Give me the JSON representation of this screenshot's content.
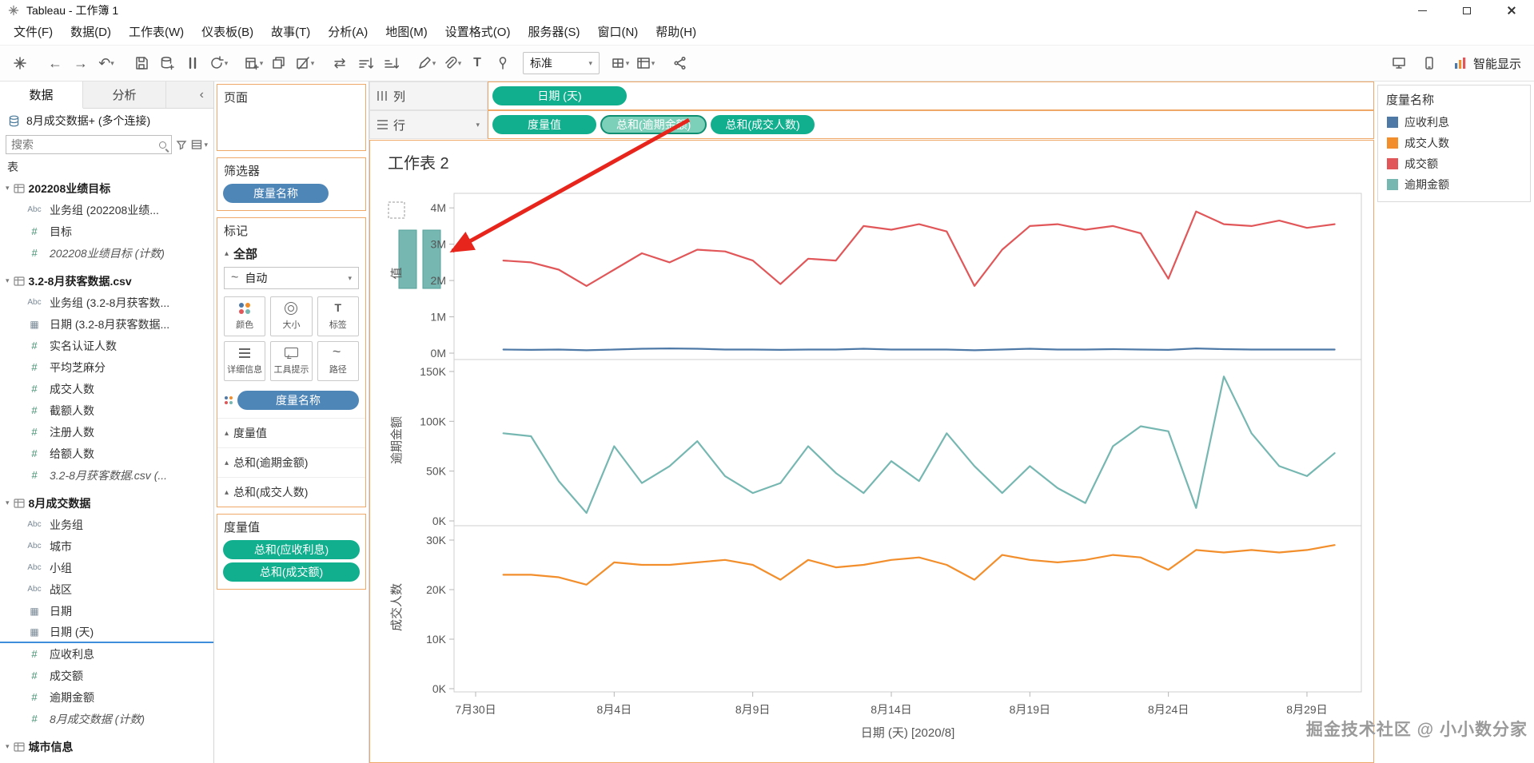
{
  "window": {
    "title": "Tableau - 工作簿 1"
  },
  "menu": {
    "items": [
      "文件(F)",
      "数据(D)",
      "工作表(W)",
      "仪表板(B)",
      "故事(T)",
      "分析(A)",
      "地图(M)",
      "设置格式(O)",
      "服务器(S)",
      "窗口(N)",
      "帮助(H)"
    ]
  },
  "toolbar": {
    "fit_label": "标准",
    "smart_show_label": "智能显示"
  },
  "sidebar": {
    "tabs": {
      "data": "数据",
      "analytics": "分析"
    },
    "datasource": "8月成交数据+ (多个连接)",
    "search": {
      "placeholder": "搜索"
    },
    "section_label": "表",
    "groups": [
      {
        "name": "202208业绩目标",
        "fields": [
          {
            "type": "abc",
            "label": "业务组 (202208业绩..."
          },
          {
            "type": "num",
            "label": "目标"
          },
          {
            "type": "num",
            "label": "202208业绩目标 (计数)",
            "generated": true
          }
        ]
      },
      {
        "name": "3.2-8月获客数据.csv",
        "fields": [
          {
            "type": "abc",
            "label": "业务组 (3.2-8月获客数..."
          },
          {
            "type": "date",
            "label": "日期 (3.2-8月获客数据..."
          },
          {
            "type": "num",
            "label": "实名认证人数"
          },
          {
            "type": "num",
            "label": "平均芝麻分"
          },
          {
            "type": "num",
            "label": "成交人数"
          },
          {
            "type": "num",
            "label": "截额人数"
          },
          {
            "type": "num",
            "label": "注册人数"
          },
          {
            "type": "num",
            "label": "给额人数"
          },
          {
            "type": "num",
            "label": "3.2-8月获客数据.csv (...",
            "generated": true
          }
        ]
      },
      {
        "name": "8月成交数据",
        "fields": [
          {
            "type": "abc",
            "label": "业务组"
          },
          {
            "type": "abc",
            "label": "城市"
          },
          {
            "type": "abc",
            "label": "小组"
          },
          {
            "type": "abc",
            "label": "战区"
          },
          {
            "type": "date",
            "label": "日期"
          },
          {
            "type": "date",
            "label": "日期 (天)",
            "drop_indicator": true
          },
          {
            "type": "num",
            "label": "应收利息"
          },
          {
            "type": "num",
            "label": "成交额"
          },
          {
            "type": "num",
            "label": "逾期金额"
          },
          {
            "type": "num",
            "label": "8月成交数据 (计数)",
            "generated": true
          }
        ]
      },
      {
        "name": "城市信息",
        "fields": []
      }
    ]
  },
  "cards": {
    "pages": {
      "title": "页面"
    },
    "filters": {
      "title": "筛选器",
      "pills": [
        {
          "label": "度量名称",
          "kind": "dimension"
        }
      ]
    },
    "marks": {
      "title": "标记",
      "all_label": "全部",
      "mark_type": "自动",
      "buttons": [
        {
          "label": "颜色",
          "icon": "color"
        },
        {
          "label": "大小",
          "icon": "size"
        },
        {
          "label": "标签",
          "icon": "text"
        },
        {
          "label": "详细信息",
          "icon": "detail"
        },
        {
          "label": "工具提示",
          "icon": "tooltip"
        },
        {
          "label": "路径",
          "icon": "path"
        }
      ],
      "pills": [
        {
          "label": "度量名称",
          "kind": "dimension"
        }
      ],
      "sections": [
        "度量值",
        "总和(逾期金额)",
        "总和(成交人数)"
      ]
    },
    "measure_values": {
      "title": "度量值",
      "pills": [
        {
          "label": "总和(应收利息)"
        },
        {
          "label": "总和(成交额)"
        }
      ]
    }
  },
  "shelves": {
    "columns": {
      "label": "列",
      "pills": [
        {
          "label": "日期 (天)",
          "kind": "measure"
        }
      ]
    },
    "rows": {
      "label": "行",
      "pills": [
        {
          "label": "度量值",
          "kind": "measure"
        },
        {
          "label": "总和(逾期金额)",
          "kind": "measure",
          "highlighted": true
        },
        {
          "label": "总和(成交人数)",
          "kind": "measure"
        }
      ]
    }
  },
  "legend": {
    "title": "度量名称",
    "items": [
      {
        "label": "应收利息",
        "color": "#4e79a7"
      },
      {
        "label": "成交人数",
        "color": "#f28e2b"
      },
      {
        "label": "成交额",
        "color": "#e15759"
      },
      {
        "label": "逾期金额",
        "color": "#76b7b2"
      }
    ]
  },
  "watermark": "掘金技术社区 @ 小小数分家",
  "chart_data": {
    "type": "line",
    "title": "工作表 2",
    "xlabel": "日期 (天) [2020/8]",
    "grid": false,
    "legend_position": "right",
    "x_tick_labels": [
      "7月30日",
      "8月4日",
      "8月9日",
      "8月14日",
      "8月19日",
      "8月24日",
      "8月29日"
    ],
    "x_tick_days": [
      0,
      5,
      10,
      15,
      20,
      25,
      30
    ],
    "series_start_day": 1,
    "panels": [
      {
        "ylabel": "值",
        "ylim": [
          0,
          4400000
        ],
        "yticks": [
          0,
          1000000,
          2000000,
          3000000,
          4000000
        ],
        "ytick_labels": [
          "0M",
          "1M",
          "2M",
          "3M",
          "4M"
        ],
        "series": [
          {
            "name": "成交额",
            "color": "#e15759",
            "values": [
              2550000,
              2500000,
              2300000,
              1850000,
              2300000,
              2750000,
              2500000,
              2850000,
              2800000,
              2550000,
              1900000,
              2600000,
              2550000,
              3500000,
              3400000,
              3550000,
              3350000,
              1850000,
              2850000,
              3500000,
              3550000,
              3400000,
              3500000,
              3300000,
              2050000,
              3900000,
              3550000,
              3500000,
              3650000,
              3450000,
              3550000
            ]
          },
          {
            "name": "应收利息",
            "color": "#4e79a7",
            "values": [
              100000,
              90000,
              100000,
              80000,
              100000,
              120000,
              130000,
              120000,
              100000,
              100000,
              90000,
              100000,
              100000,
              120000,
              100000,
              100000,
              100000,
              80000,
              100000,
              120000,
              100000,
              100000,
              110000,
              100000,
              90000,
              130000,
              110000,
              100000,
              100000,
              100000,
              100000
            ]
          }
        ]
      },
      {
        "ylabel": "逾期金额",
        "ylim": [
          0,
          162000
        ],
        "yticks": [
          0,
          50000,
          100000,
          150000
        ],
        "ytick_labels": [
          "0K",
          "50K",
          "100K",
          "150K"
        ],
        "series": [
          {
            "name": "逾期金额",
            "color": "#76b7b2",
            "values": [
              88000,
              85000,
              40000,
              8000,
              75000,
              38000,
              55000,
              80000,
              45000,
              28000,
              38000,
              75000,
              48000,
              28000,
              60000,
              40000,
              88000,
              55000,
              28000,
              55000,
              33000,
              18000,
              75000,
              95000,
              90000,
              13000,
              145000,
              88000,
              55000,
              45000,
              68000
            ]
          }
        ]
      },
      {
        "ylabel": "成交人数",
        "ylim": [
          0,
          32900
        ],
        "yticks": [
          0,
          10000,
          20000,
          30000
        ],
        "ytick_labels": [
          "0K",
          "10K",
          "20K",
          "30K"
        ],
        "series": [
          {
            "name": "成交人数",
            "color": "#f28e2b",
            "values": [
              23000,
              23000,
              22500,
              21000,
              25500,
              25000,
              25000,
              25500,
              26000,
              25000,
              22000,
              26000,
              24500,
              25000,
              26000,
              26500,
              25000,
              22000,
              27000,
              26000,
              25500,
              26000,
              27000,
              26500,
              24000,
              28000,
              27500,
              28000,
              27500,
              28000,
              29000
            ]
          }
        ]
      }
    ],
    "annotation": {
      "bar_color": "#76b7b2",
      "bars": [
        [
          36,
          112,
          22,
          73
        ],
        [
          66,
          112,
          22,
          73
        ]
      ],
      "dashed_box": [
        23,
        77,
        20,
        20
      ],
      "arrow_color": "#e8251c"
    }
  }
}
